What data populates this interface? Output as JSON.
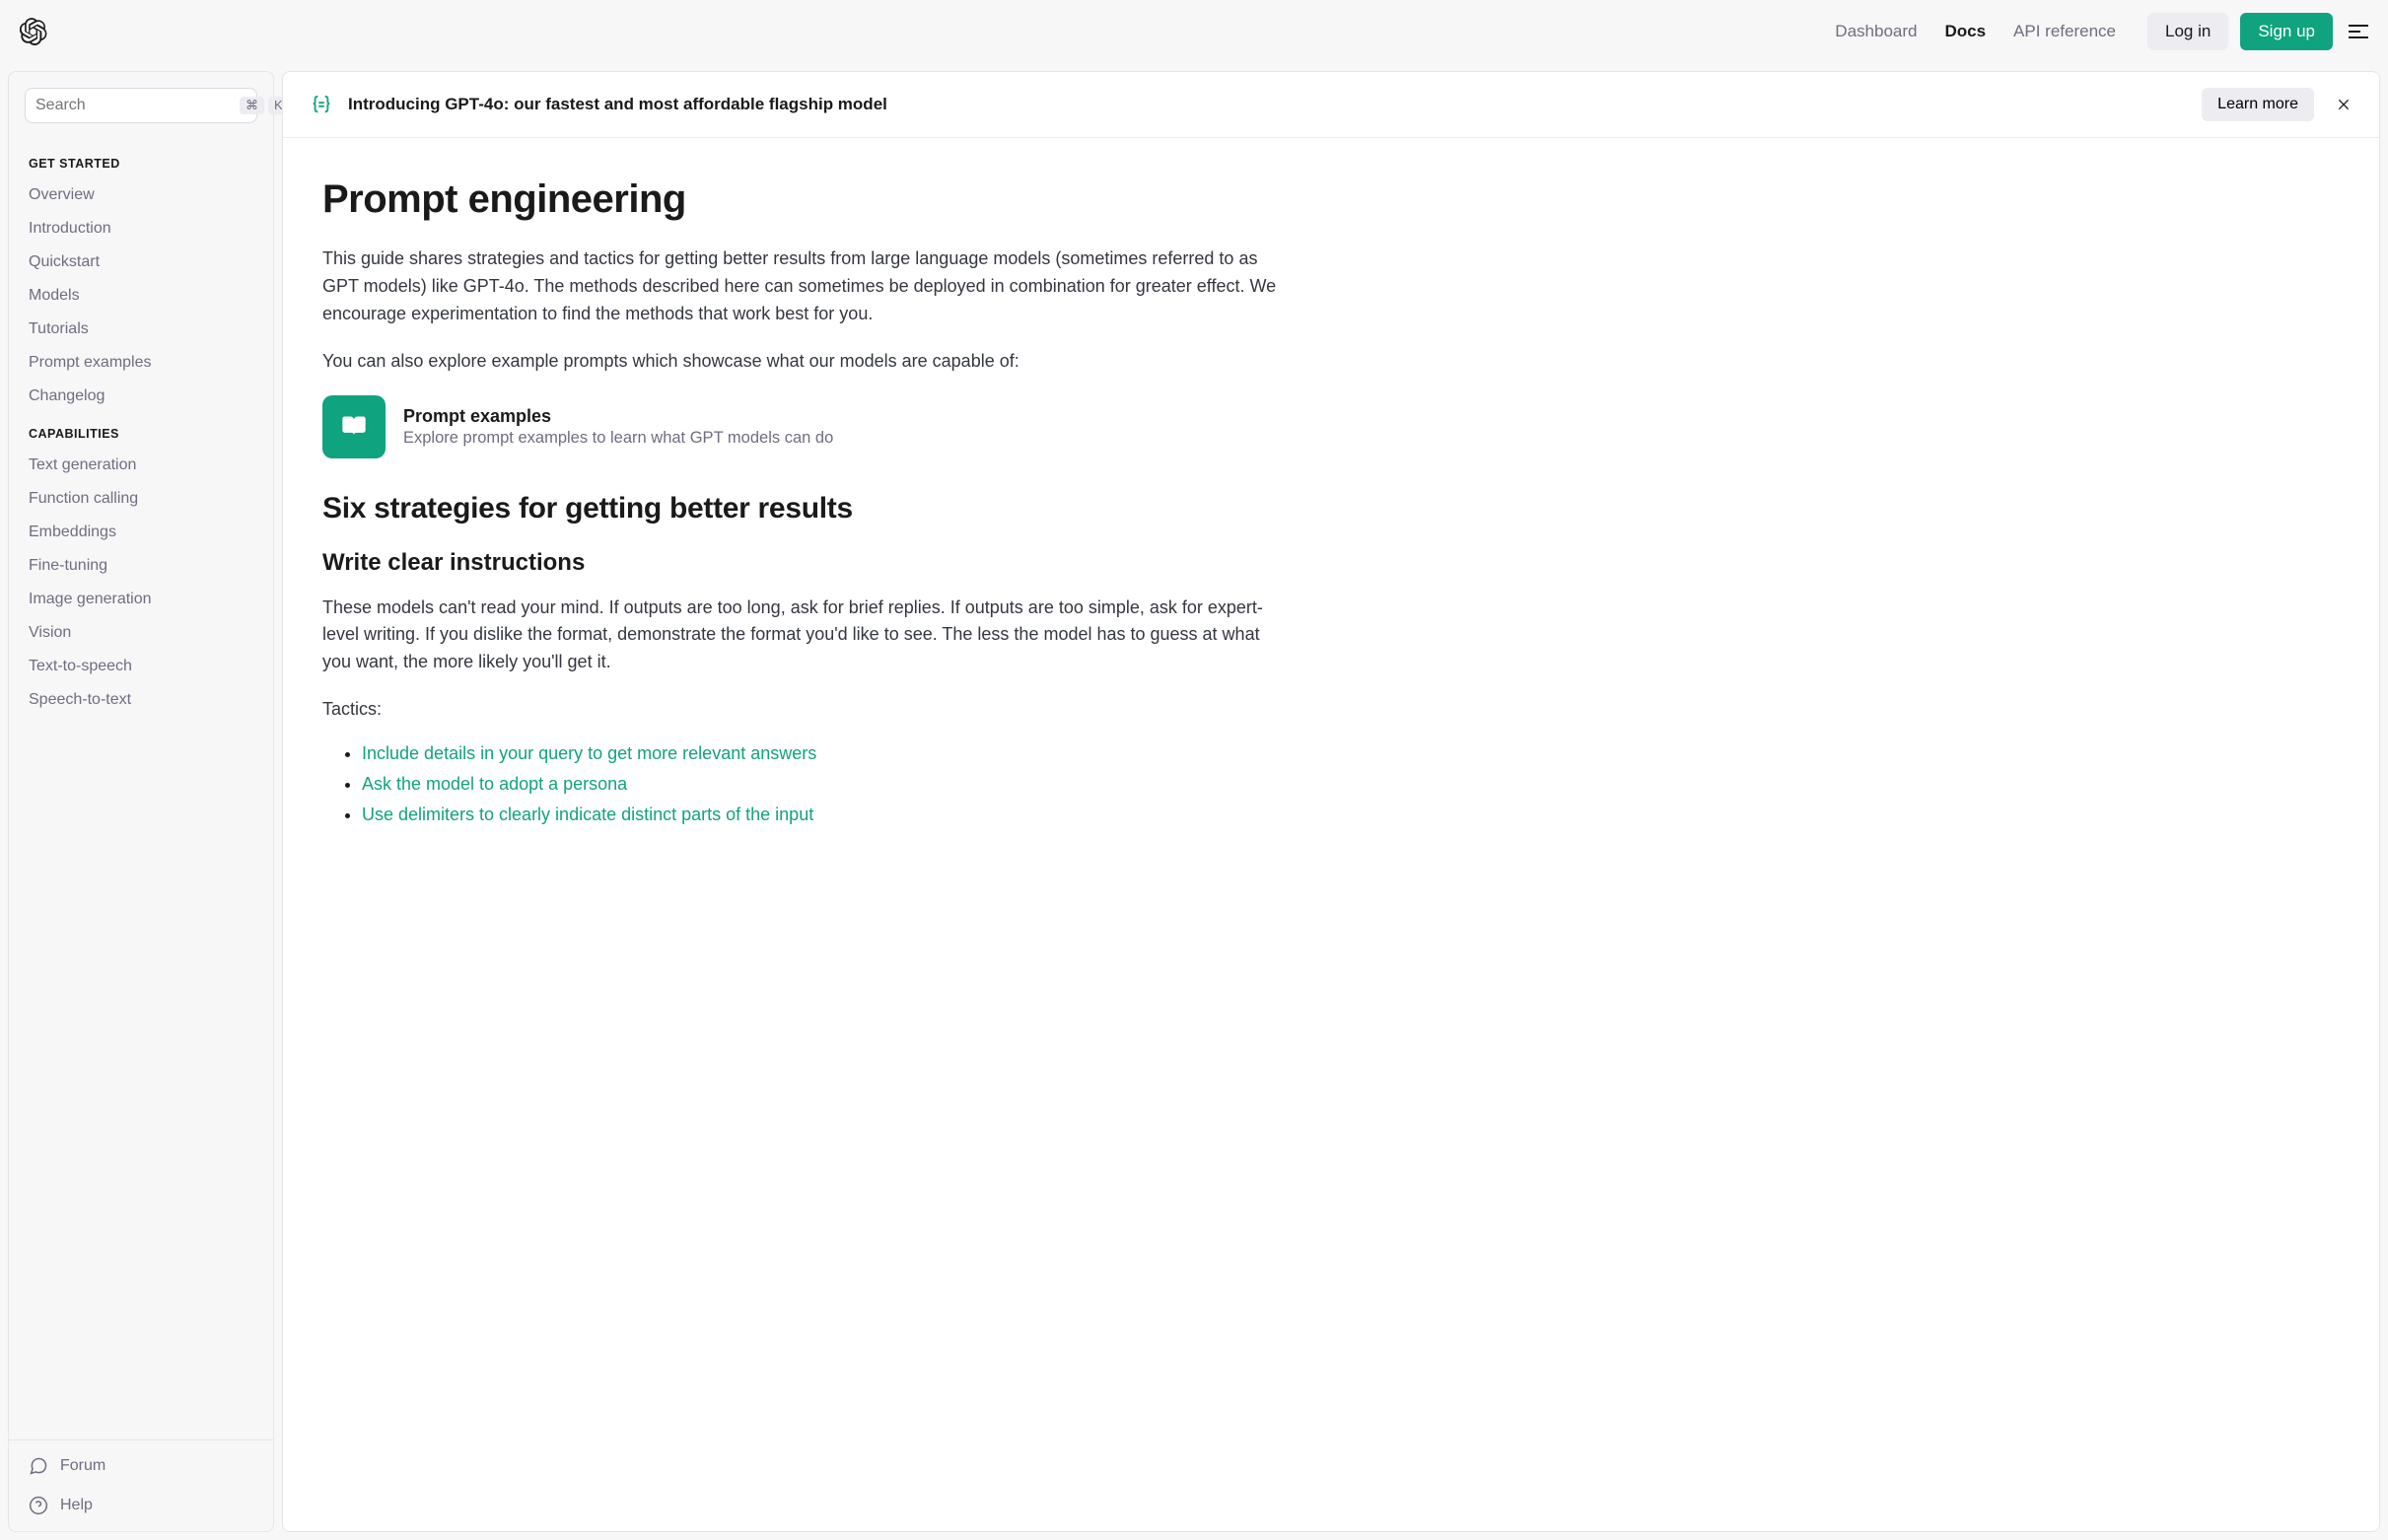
{
  "header": {
    "nav": [
      {
        "label": "Dashboard",
        "active": false
      },
      {
        "label": "Docs",
        "active": true
      },
      {
        "label": "API reference",
        "active": false
      }
    ],
    "login": "Log in",
    "signup": "Sign up"
  },
  "search": {
    "placeholder": "Search",
    "shortcut_cmd": "⌘",
    "shortcut_key": "K"
  },
  "sidebar": {
    "sections": [
      {
        "title": "GET STARTED",
        "items": [
          "Overview",
          "Introduction",
          "Quickstart",
          "Models",
          "Tutorials",
          "Prompt examples",
          "Changelog"
        ]
      },
      {
        "title": "CAPABILITIES",
        "items": [
          "Text generation",
          "Function calling",
          "Embeddings",
          "Fine-tuning",
          "Image generation",
          "Vision",
          "Text-to-speech",
          "Speech-to-text"
        ]
      }
    ],
    "footer": [
      {
        "icon": "forum",
        "label": "Forum"
      },
      {
        "icon": "help",
        "label": "Help"
      }
    ]
  },
  "banner": {
    "text": "Introducing GPT-4o: our fastest and most affordable flagship model",
    "cta": "Learn more"
  },
  "article": {
    "title": "Prompt engineering",
    "intro1": "This guide shares strategies and tactics for getting better results from large language models (sometimes referred to as GPT models) like GPT-4o. The methods described here can sometimes be deployed in combination for greater effect. We encourage experimentation to find the methods that work best for you.",
    "intro2": "You can also explore example prompts which showcase what our models are capable of:",
    "card": {
      "title": "Prompt examples",
      "subtitle": "Explore prompt examples to learn what GPT models can do"
    },
    "h2": "Six strategies for getting better results",
    "h3": "Write clear instructions",
    "strategy_para": "These models can't read your mind. If outputs are too long, ask for brief replies. If outputs are too simple, ask for expert-level writing. If you dislike the format, demonstrate the format you'd like to see. The less the model has to guess at what you want, the more likely you'll get it.",
    "tactics_label": "Tactics:",
    "tactics": [
      "Include details in your query to get more relevant answers",
      "Ask the model to adopt a persona",
      "Use delimiters to clearly indicate distinct parts of the input"
    ]
  }
}
